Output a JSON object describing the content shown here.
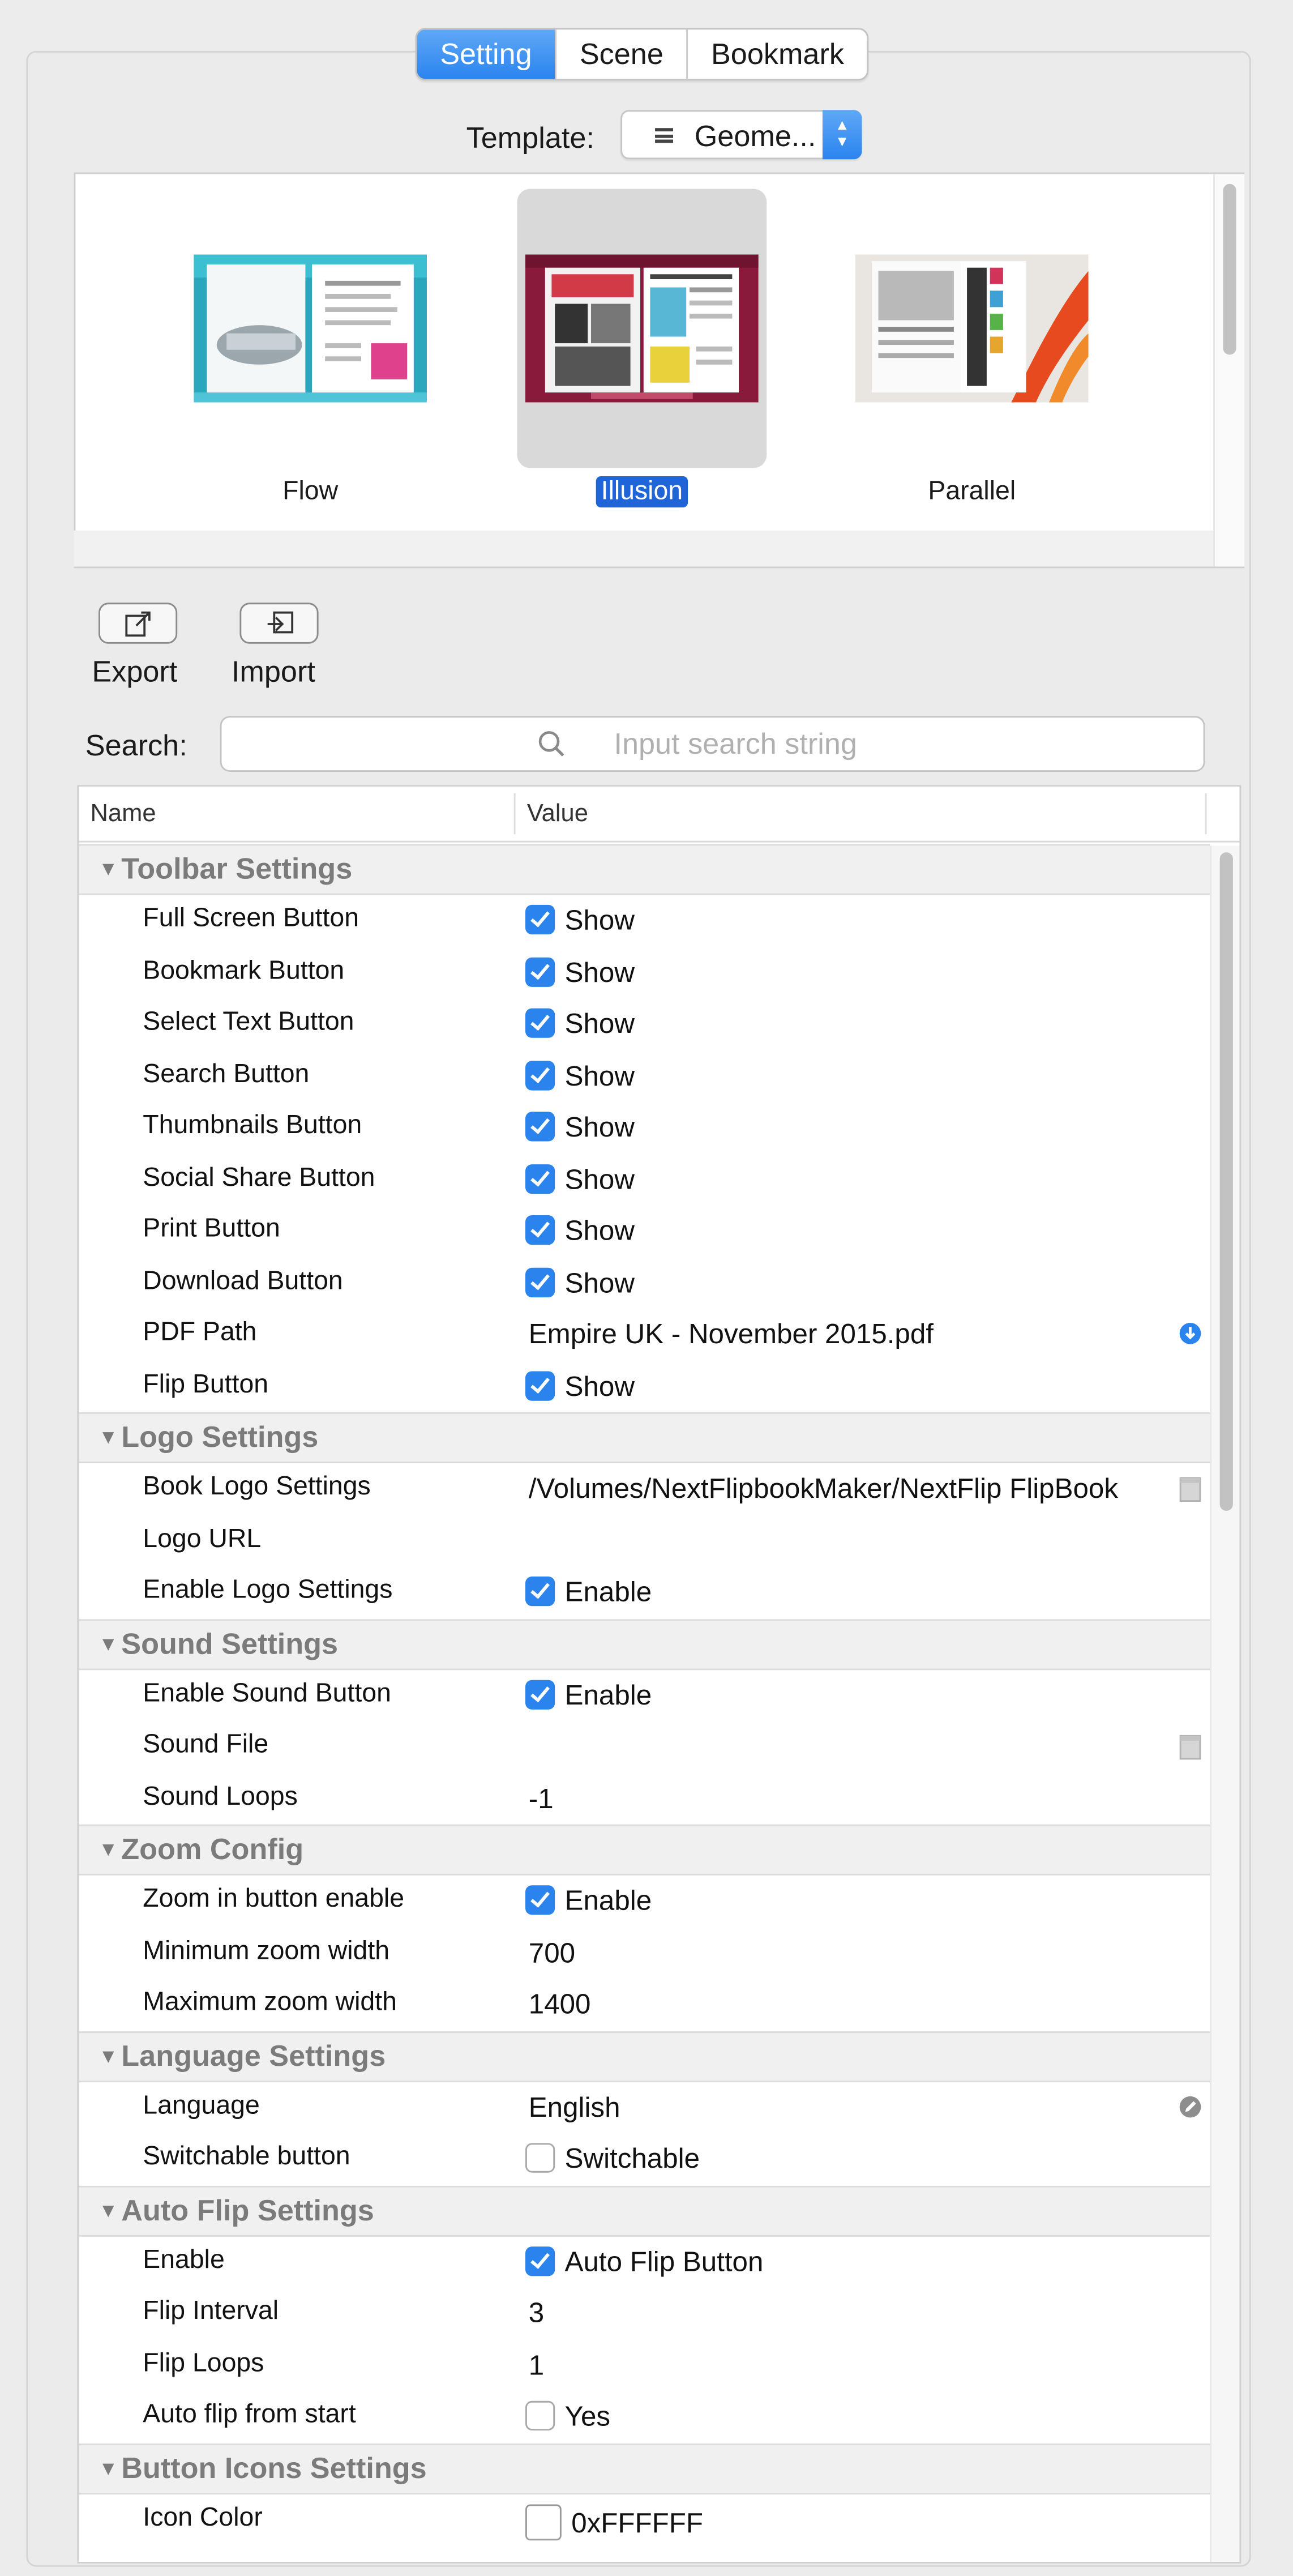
{
  "tabs": [
    {
      "label": "Setting",
      "active": true
    },
    {
      "label": "Scene",
      "active": false
    },
    {
      "label": "Bookmark",
      "active": false
    }
  ],
  "template": {
    "label": "Template:",
    "selected": "Geome..."
  },
  "templates": [
    {
      "name": "Flow",
      "selected": false
    },
    {
      "name": "Illusion",
      "selected": true
    },
    {
      "name": "Parallel",
      "selected": false
    }
  ],
  "toolbar": {
    "export_label": "Export",
    "import_label": "Import"
  },
  "search": {
    "label": "Search:",
    "placeholder": "Input search string"
  },
  "table": {
    "name_header": "Name",
    "value_header": "Value",
    "groups": [
      {
        "title": "Toolbar Settings",
        "rows": [
          {
            "name": "Full Screen Button",
            "type": "checkbox",
            "checked": true,
            "value": "Show"
          },
          {
            "name": "Bookmark Button",
            "type": "checkbox",
            "checked": true,
            "value": "Show"
          },
          {
            "name": "Select Text Button",
            "type": "checkbox",
            "checked": true,
            "value": "Show"
          },
          {
            "name": "Search Button",
            "type": "checkbox",
            "checked": true,
            "value": "Show"
          },
          {
            "name": "Thumbnails Button",
            "type": "checkbox",
            "checked": true,
            "value": "Show"
          },
          {
            "name": "Social Share Button",
            "type": "checkbox",
            "checked": true,
            "value": "Show"
          },
          {
            "name": "Print Button",
            "type": "checkbox",
            "checked": true,
            "value": "Show"
          },
          {
            "name": "Download Button",
            "type": "checkbox",
            "checked": true,
            "value": "Show"
          },
          {
            "name": "PDF Path",
            "type": "text",
            "value": "Empire UK - November 2015.pdf",
            "icon": "download-icon"
          },
          {
            "name": "Flip Button",
            "type": "checkbox",
            "checked": true,
            "value": "Show"
          }
        ]
      },
      {
        "title": "Logo Settings",
        "rows": [
          {
            "name": "Book Logo Settings",
            "type": "text",
            "value": "/Volumes/NextFlipbookMaker/NextFlip FlipBook",
            "icon": "file-icon"
          },
          {
            "name": "Logo URL",
            "type": "text",
            "value": ""
          },
          {
            "name": "Enable Logo Settings",
            "type": "checkbox",
            "checked": true,
            "value": "Enable"
          }
        ]
      },
      {
        "title": "Sound Settings",
        "rows": [
          {
            "name": "Enable Sound Button",
            "type": "checkbox",
            "checked": true,
            "value": "Enable"
          },
          {
            "name": "Sound File",
            "type": "text",
            "value": "",
            "icon": "file-icon"
          },
          {
            "name": "Sound Loops",
            "type": "text",
            "value": "-1"
          }
        ]
      },
      {
        "title": "Zoom Config",
        "rows": [
          {
            "name": "Zoom in button enable",
            "type": "checkbox",
            "checked": true,
            "value": "Enable"
          },
          {
            "name": "Minimum zoom width",
            "type": "text",
            "value": "700"
          },
          {
            "name": "Maximum zoom width",
            "type": "text",
            "value": "1400"
          }
        ]
      },
      {
        "title": "Language Settings",
        "rows": [
          {
            "name": "Language",
            "type": "text",
            "value": "English",
            "icon": "edit-icon"
          },
          {
            "name": "Switchable button",
            "type": "checkbox",
            "checked": false,
            "value": "Switchable"
          }
        ]
      },
      {
        "title": "Auto Flip Settings",
        "rows": [
          {
            "name": "Enable",
            "type": "checkbox",
            "checked": true,
            "value": "Auto Flip Button"
          },
          {
            "name": "Flip Interval",
            "type": "text",
            "value": "3"
          },
          {
            "name": "Flip Loops",
            "type": "text",
            "value": "1"
          },
          {
            "name": "Auto flip from start",
            "type": "checkbox",
            "checked": false,
            "value": "Yes"
          }
        ]
      },
      {
        "title": "Button Icons Settings",
        "rows": [
          {
            "name": "Icon Color",
            "type": "color",
            "color": "#FFFFFF",
            "value": "0xFFFFFF"
          }
        ]
      }
    ]
  },
  "colors": {
    "accent": "#2b84ee",
    "selection": "#1f65d8"
  }
}
